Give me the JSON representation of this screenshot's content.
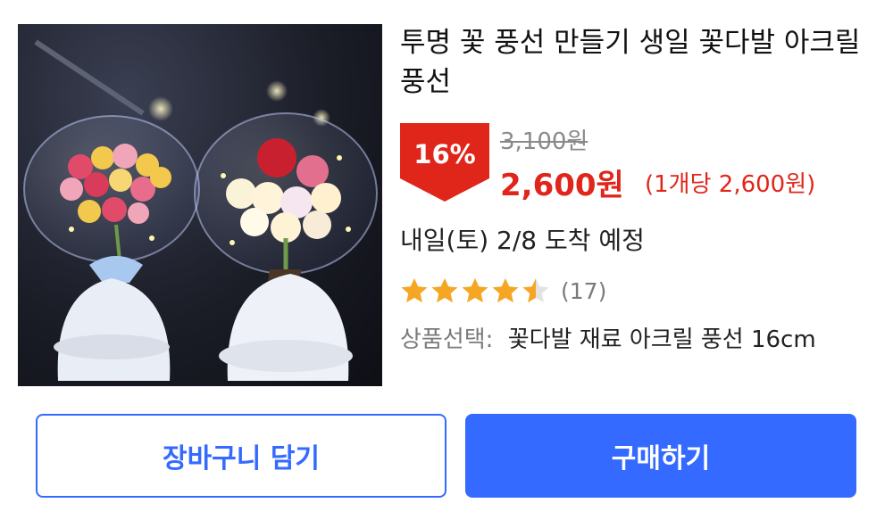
{
  "product": {
    "title": "투명 꽃 풍선 만들기 생일 꽃다발 아크릴 풍선",
    "discount_badge": "16%",
    "original_price": "3,100원",
    "sale_price": "2,600원",
    "unit_price": "(1개당 2,600원)",
    "delivery": "내일(토) 2/8 도착 예정",
    "rating": 4.5,
    "review_count": "(17)",
    "option_label": "상품선택:",
    "option_value": "꽃다발 재료 아크릴 풍선 16cm"
  },
  "actions": {
    "cart_label": "장바구니 담기",
    "buy_label": "구매하기"
  },
  "colors": {
    "accent_blue": "#346aff",
    "sale_red": "#e0261b",
    "star_gold": "#f5a623"
  }
}
